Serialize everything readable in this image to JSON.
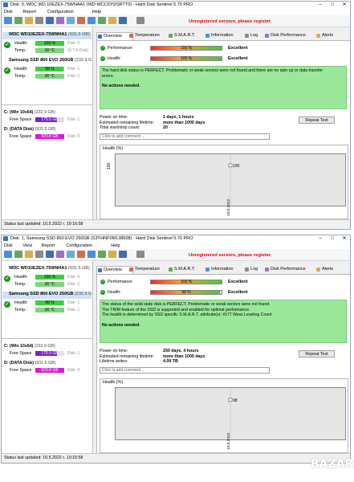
{
  "windows": [
    {
      "title": "Disk: 0, WDC WD 10EZEX-75WNAA1 (WD-WCC6Y0/SRTT0) - Hard Disk Sentinel 5.70 PRO",
      "menu": [
        "Disk",
        "Report",
        "Configuration",
        "Help"
      ],
      "unregistered": "Unregistered version, please register.",
      "disks": [
        {
          "name": "WDC WD10EZEX-75WNHA1",
          "size": "(931.5 GB)",
          "selected": true,
          "health_label": "Health:",
          "health_value": "100 %",
          "health_fraction": 1.0,
          "health_hint": "Disk: 0",
          "temp_label": "Temp.:",
          "temp_value": "30 °C",
          "temp_hint": "(S:T.A Disk)"
        },
        {
          "name": "Samsung SSD 860 EVO 250GB",
          "size": "(232.9 GB)",
          "selected": false,
          "health_label": "Health:",
          "health_value": "98 %",
          "health_fraction": 0.98,
          "health_hint": "Disk: 1",
          "temp_label": "Temp.:",
          "temp_value": "30 °C",
          "temp_hint": "Disk: 1"
        }
      ],
      "volumes": [
        {
          "name": "C: (Win 10x64)",
          "size": "(232.9 GB)",
          "label": "Free Space",
          "value": "175.5 GB",
          "fraction": 0.75,
          "hint": "Disk: 1",
          "color": "#7b1fd6"
        },
        {
          "name": "D: (DATA Disk)",
          "size": "(931.5 GB)",
          "label": "Free Space",
          "value": "929.8 GB",
          "fraction": 1.0,
          "hint": "Disk: 0",
          "color": "#d81bd8"
        }
      ],
      "status": "Status last updated: 10.5.2022 r. 10:16:58",
      "tabs": [
        "Overview",
        "Temperature",
        "S.M.A.R.T.",
        "Information",
        "Log",
        "Disk Performance",
        "Alerts"
      ],
      "performance": {
        "label": "Performance:",
        "value": "100 %",
        "fraction": 1.0,
        "rating": "Excellent"
      },
      "health": {
        "label": "Health:",
        "value": "100 %",
        "fraction": 1.0,
        "rating": "Excellent"
      },
      "message_lines": [
        "The hard disk status is PERFECT. Problematic or weak sectors were not found and there are no spin up or data transfer",
        "errors."
      ],
      "actions": "No actions needed.",
      "info_rows": [
        {
          "label": "Power on time:",
          "value": "1 days, 1 hours"
        },
        {
          "label": "Estimated remaining lifetime:",
          "value": "more than 1000 days"
        },
        {
          "label": "Total start/stop count:",
          "value": "20"
        }
      ],
      "repeat_test": "Repeat Test",
      "comment_placeholder": "Click to add comment ...",
      "health_chart_title": "Health (%)",
      "chart_data": {
        "type": "line",
        "title": "Health (%)",
        "x": [
          "10.5.2022"
        ],
        "values": [
          100
        ],
        "y_ticks": [
          "100"
        ],
        "point_label": "100"
      }
    },
    {
      "title": "Disk: 1, Samsung SSD 860 EVO 250GB (S3YHNF0M138508) - Hard Disk Sentinel 5.70 PRO",
      "menu": [
        "Disk",
        "View",
        "Report",
        "Configuration",
        "Help"
      ],
      "unregistered": "Unregistered version, please register.",
      "disks": [
        {
          "name": "WDC WD10EZEX-75WNHA1",
          "size": "(931.5 GB)",
          "selected": false,
          "health_label": "Health:",
          "health_value": "100 %",
          "health_fraction": 1.0,
          "health_hint": "Disk: 0",
          "temp_label": "Temp.:",
          "temp_value": "30 °C",
          "temp_hint": "Disk: 0"
        },
        {
          "name": "Samsung SSD 860 EVO 250GB",
          "size": "(232.9 GB)",
          "selected": true,
          "health_label": "Health:",
          "health_value": "98 %",
          "health_fraction": 0.98,
          "health_hint": "Disk: 1",
          "temp_label": "Temp.:",
          "temp_value": "30 °C",
          "temp_hint": "Disk: 1"
        }
      ],
      "volumes": [
        {
          "name": "C: (Win 10x64)",
          "size": "(232.9 GB)",
          "label": "Free Space",
          "value": "175.5 GB",
          "fraction": 0.75,
          "hint": "Disk: 1",
          "color": "#7b1fd6"
        },
        {
          "name": "D: (DATA Disk)",
          "size": "(931.5 GB)",
          "label": "Free Space",
          "value": "929.8 GB",
          "fraction": 1.0,
          "hint": "Disk: 0",
          "color": "#d81bd8"
        }
      ],
      "status": "Status last updated: 10.5.2022 r. 10:16:58",
      "tabs": [
        "Overview",
        "Temperature",
        "S.M.A.R.T.",
        "Information",
        "Log",
        "Disk Performance",
        "Alerts"
      ],
      "performance": {
        "label": "Performance:",
        "value": "100 %",
        "fraction": 1.0,
        "rating": "Excellent"
      },
      "health": {
        "label": "Health:",
        "value": "98 %",
        "fraction": 0.98,
        "rating": "Excellent"
      },
      "message_lines": [
        "The status of the solid state disk is PERFECT. Problematic or weak sectors were not found.",
        "The TRIM feature of the SSD is supported and enabled for optimal performance.",
        "The health is determined by SSD specific S.M.A.R.T. attribute(s): #177 Wear Leveling Count"
      ],
      "actions": "No actions needed.",
      "info_rows": [
        {
          "label": "Power on time:",
          "value": "250 days, 4 hours"
        },
        {
          "label": "Estimated remaining lifetime:",
          "value": "more than 1000 days"
        },
        {
          "label": "Lifetime writes:",
          "value": "4.09 TB"
        }
      ],
      "repeat_test": "Repeat Test",
      "comment_placeholder": "Click to add comment ...",
      "health_chart_title": "Health (%)",
      "chart_data": {
        "type": "line",
        "title": "Health (%)",
        "x": [
          "10.5.2022"
        ],
        "values": [
          98
        ],
        "y_ticks": [],
        "point_label": "98"
      }
    }
  ],
  "watermark": "BAZAR"
}
